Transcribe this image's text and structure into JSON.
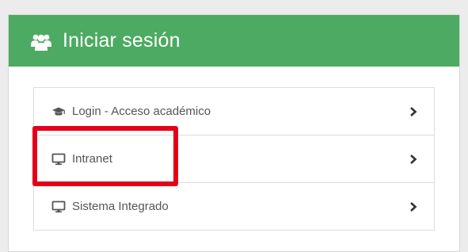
{
  "panel": {
    "title": "Iniciar sesión",
    "title_icon": "users-icon",
    "header_color": "#4daa62"
  },
  "items": [
    {
      "label": "Login - Acceso académico",
      "icon": "graduation-cap-icon",
      "action_icon": "chevron-right-icon"
    },
    {
      "label": "Intranet",
      "icon": "desktop-icon",
      "action_icon": "chevron-right-icon",
      "highlighted": true
    },
    {
      "label": "Sistema Integrado",
      "icon": "desktop-icon",
      "action_icon": "chevron-right-icon"
    }
  ],
  "highlight_color": "#e3001b"
}
